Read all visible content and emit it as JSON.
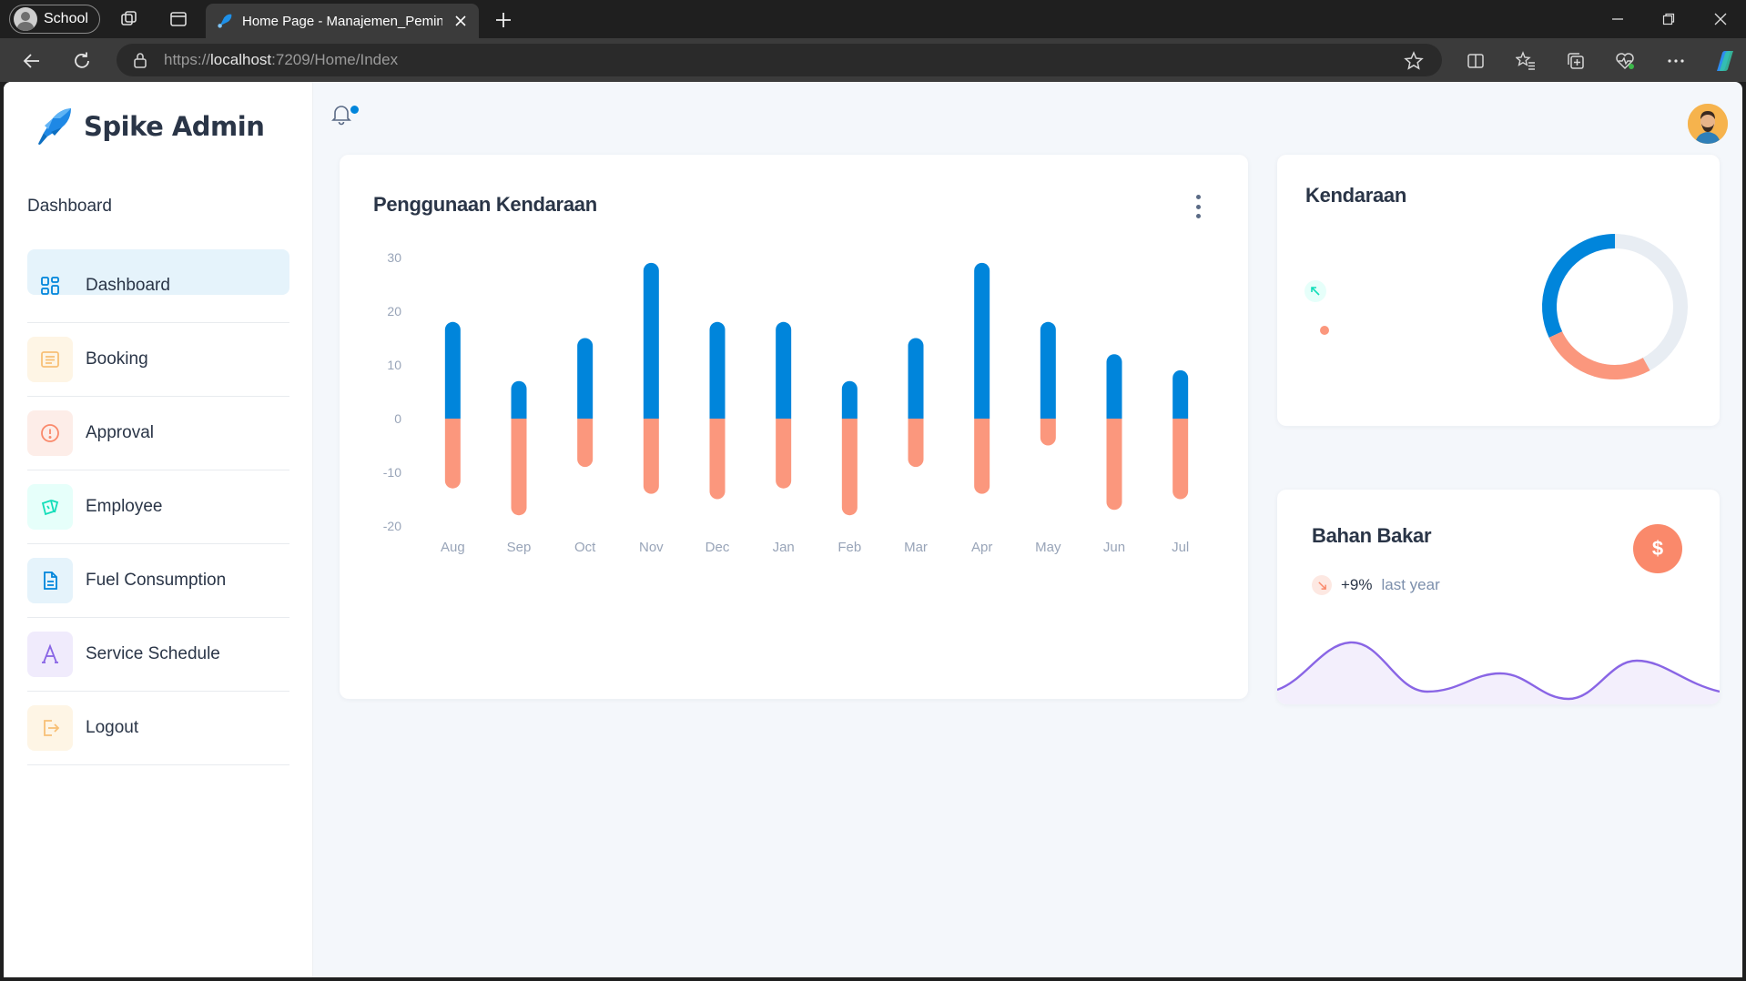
{
  "browser": {
    "profile": "School",
    "tab_title": "Home Page - Manajemen_Peminja",
    "url_scheme": "https://",
    "url_host": "localhost",
    "url_rest": ":7209/Home/Index"
  },
  "brand": {
    "name": "Spike Admin"
  },
  "sidebar": {
    "heading": "Dashboard",
    "items": [
      {
        "label": "Dashboard",
        "icon": "dashboard-icon",
        "color": "#0085db",
        "bg": "#e5f3fb",
        "active": true
      },
      {
        "label": "Booking",
        "icon": "list-icon",
        "color": "#f8c076",
        "bg": "#fef5e5"
      },
      {
        "label": "Approval",
        "icon": "alert-circle-icon",
        "color": "#fa896b",
        "bg": "#fdede8"
      },
      {
        "label": "Employee",
        "icon": "cards-icon",
        "color": "#46caeb",
        "bg": "#e6fffa"
      },
      {
        "label": "Fuel Consumption",
        "icon": "file-icon",
        "color": "#0085db",
        "bg": "#e5f3fb"
      },
      {
        "label": "Service Schedule",
        "icon": "typography-icon",
        "color": "#8965e5",
        "bg": "#f0ebfc"
      },
      {
        "label": "Logout",
        "icon": "login-icon",
        "color": "#f8c076",
        "bg": "#fef5e5"
      }
    ]
  },
  "usage_card": {
    "title": "Penggunaan Kendaraan"
  },
  "chart_data": {
    "type": "bar",
    "stacked": true,
    "categories": [
      "Aug",
      "Sep",
      "Oct",
      "Nov",
      "Dec",
      "Jan",
      "Feb",
      "Mar",
      "Apr",
      "May",
      "Jun",
      "Jul"
    ],
    "series": [
      {
        "values": [
          18,
          7,
          15,
          29,
          18,
          18,
          7,
          15,
          29,
          18,
          12,
          9
        ],
        "color": "#0085db"
      },
      {
        "values": [
          -13,
          -18,
          -9,
          -14,
          -15,
          -13,
          -18,
          -9,
          -14,
          -5,
          -17,
          -15
        ],
        "color": "#fb977d"
      }
    ],
    "yticks": [
      "30",
      "20",
      "10",
      "0",
      "-10",
      "-20"
    ],
    "ylim": [
      -20,
      30
    ],
    "grid": false
  },
  "vehicle_card": {
    "title": "Kendaraan",
    "donut": {
      "primary_fraction": 0.32,
      "secondary_fraction": 0.26,
      "primary_color": "#0085db",
      "secondary_color": "#fb977d",
      "track_color": "#e8edf3"
    }
  },
  "fuel_card": {
    "title": "Bahan Bakar",
    "trend_value": "+9%",
    "trend_label": "last year",
    "icon": "dollar-icon",
    "dollar_symbol": "$",
    "wave_color": "#8965e5"
  }
}
